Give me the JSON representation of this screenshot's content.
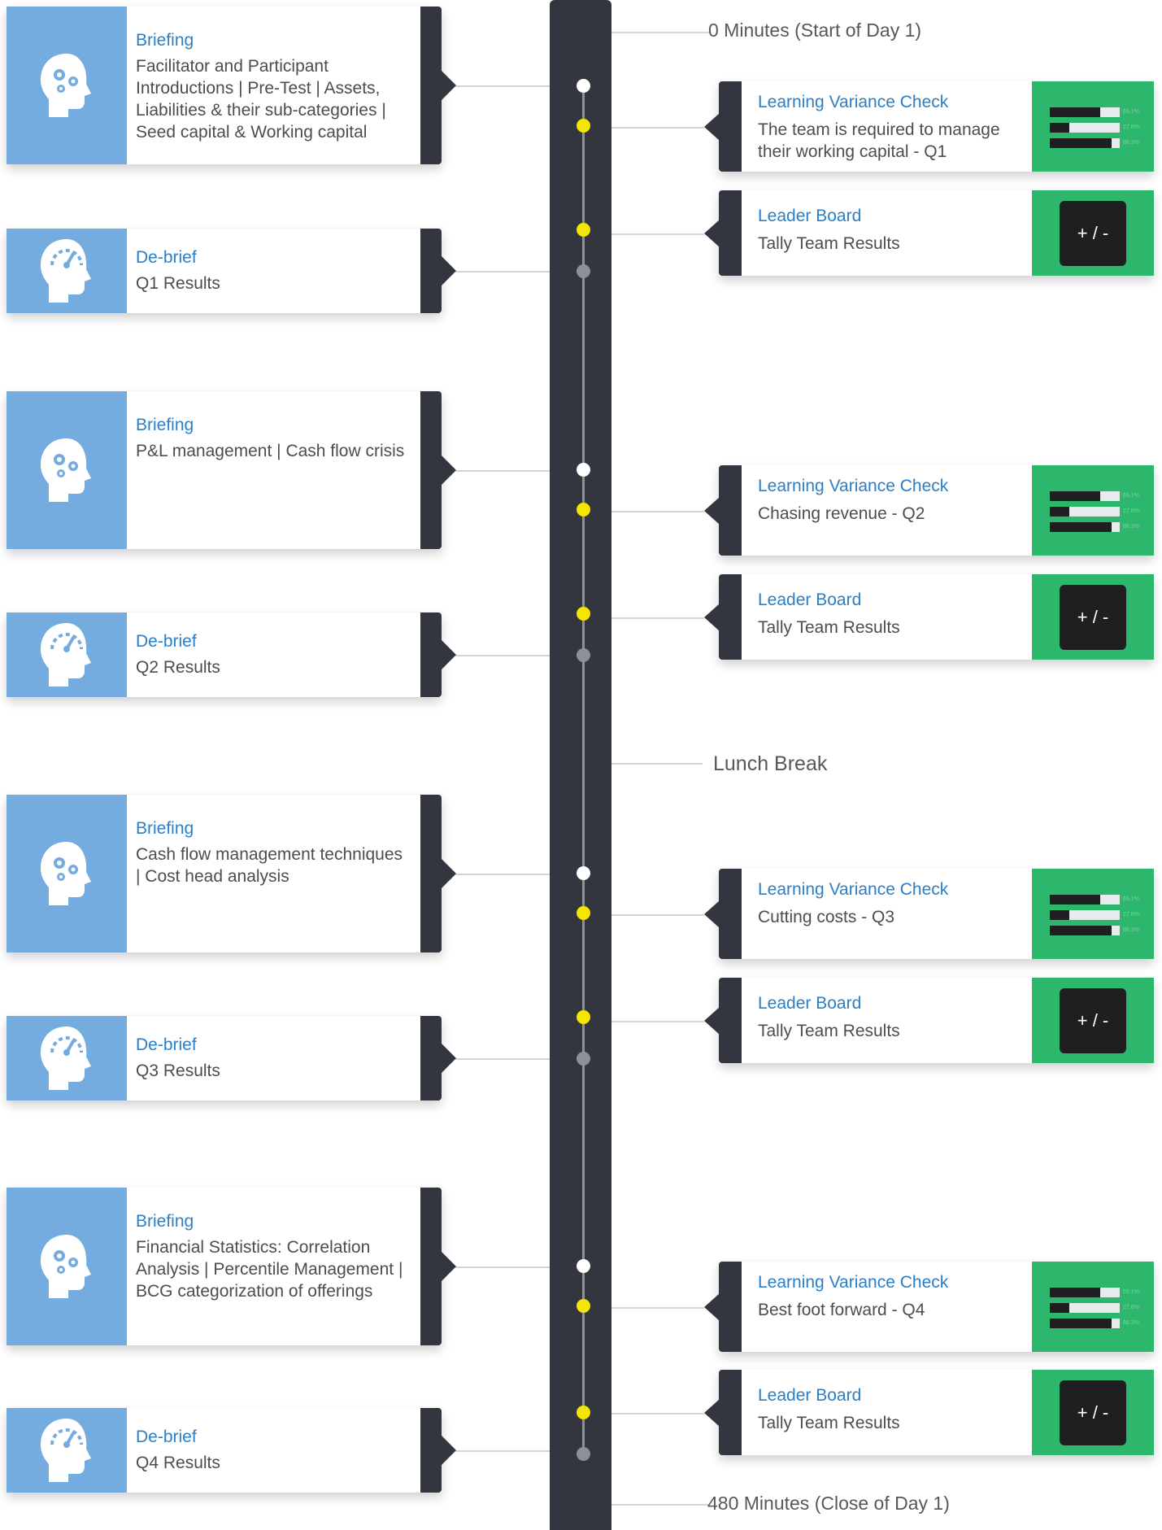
{
  "timeline": {
    "start_label": "0 Minutes (Start of Day 1)",
    "break_label": "Lunch Break",
    "end_label": "480 Minutes (Close of Day 1)"
  },
  "colors": {
    "spine": "#33363f",
    "icon_panel": "#74ace0",
    "title_blue": "#2a7fc6",
    "green_panel": "#2cb76d",
    "dot_yellow": "#f3e600",
    "dot_grey": "#8d9096"
  },
  "quarters": [
    {
      "briefing": {
        "title": "Briefing",
        "description": "Facilitator and Participant Introductions | Pre-Test | Assets, Liabilities & their sub-categories | Seed capital & Working capital",
        "icon": "gears-head-icon"
      },
      "learning_check": {
        "title": "Learning Variance Check",
        "description": "The team is required to manage their working capital - Q1"
      },
      "leader_board": {
        "title": "Leader Board",
        "description": "Tally Team Results",
        "button": "+ / -"
      },
      "debrief": {
        "title": "De-brief",
        "description": "Q1 Results",
        "icon": "gauge-head-icon"
      }
    },
    {
      "briefing": {
        "title": "Briefing",
        "description": "P&L management | Cash flow crisis",
        "icon": "gears-head-icon"
      },
      "learning_check": {
        "title": "Learning Variance Check",
        "description": "Chasing revenue - Q2"
      },
      "leader_board": {
        "title": "Leader Board",
        "description": "Tally Team Results",
        "button": "+ / -"
      },
      "debrief": {
        "title": "De-brief",
        "description": "Q2 Results",
        "icon": "gauge-head-icon"
      }
    },
    {
      "briefing": {
        "title": "Briefing",
        "description": "Cash flow management techniques | Cost head analysis",
        "icon": "gears-head-icon"
      },
      "learning_check": {
        "title": "Learning Variance Check",
        "description": "Cutting costs - Q3"
      },
      "leader_board": {
        "title": "Leader Board",
        "description": "Tally Team Results",
        "button": "+ / -"
      },
      "debrief": {
        "title": "De-brief",
        "description": "Q3 Results",
        "icon": "gauge-head-icon"
      }
    },
    {
      "briefing": {
        "title": "Briefing",
        "description": "Financial Statistics: Correlation Analysis | Percentile Management | BCG categorization of offerings",
        "icon": "gears-head-icon"
      },
      "learning_check": {
        "title": "Learning Variance Check",
        "description": "Best foot forward - Q4"
      },
      "leader_board": {
        "title": "Leader Board",
        "description": "Tally Team Results",
        "button": "+ / -"
      },
      "debrief": {
        "title": "De-brief",
        "description": "Q4 Results",
        "icon": "gauge-head-icon"
      }
    }
  ],
  "mini_chart": {
    "fills": [
      0.72,
      0.28,
      0.88
    ],
    "labels": [
      "69.1%",
      "27.6%",
      "88.3%"
    ]
  }
}
